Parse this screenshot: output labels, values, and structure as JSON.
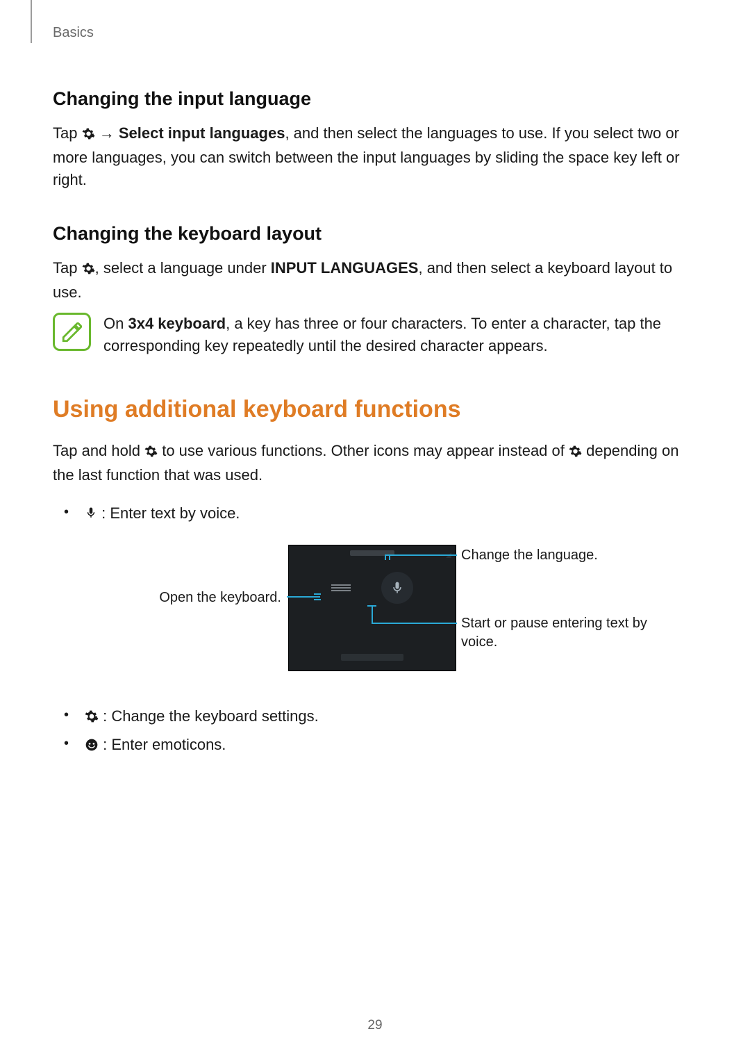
{
  "breadcrumb": "Basics",
  "page_number": "29",
  "s1": {
    "heading": "Changing the input language",
    "p_pre": "Tap ",
    "p_mid1": " → ",
    "p_bold": "Select input languages",
    "p_post": ", and then select the languages to use. If you select two or more languages, you can switch between the input languages by sliding the space key left or right."
  },
  "s2": {
    "heading": "Changing the keyboard layout",
    "p_pre": "Tap ",
    "p_mid": ", select a language under ",
    "p_bold": "INPUT LANGUAGES",
    "p_post": ", and then select a keyboard layout to use."
  },
  "note": {
    "pre": "On ",
    "bold": "3x4 keyboard",
    "post": ", a key has three or four characters. To enter a character, tap the corresponding key repeatedly until the desired character appears."
  },
  "s3": {
    "heading": "Using additional keyboard functions",
    "p_pre": "Tap and hold ",
    "p_mid": " to use various functions. Other icons may appear instead of ",
    "p_post": " depending on the last function that was used."
  },
  "bullets": {
    "voice": " : Enter text by voice.",
    "settings": " : Change the keyboard settings.",
    "emoticons": " : Enter emoticons."
  },
  "figure": {
    "left_label": "Open the keyboard.",
    "right_top": "Change the language.",
    "right_bottom": "Start or pause entering text by voice."
  }
}
